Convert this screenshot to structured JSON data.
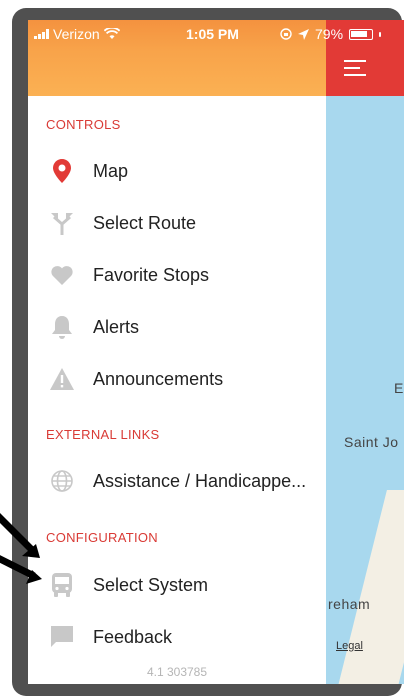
{
  "status_bar": {
    "carrier": "Verizon",
    "time": "1:05 PM",
    "battery": "79%"
  },
  "map": {
    "labels": [
      "E",
      "Saint Jo",
      "reham"
    ],
    "legal_link": "Legal"
  },
  "drawer": {
    "sections": [
      {
        "title": "CONTROLS",
        "items": [
          {
            "label": "Map",
            "icon": "map-pin-icon"
          },
          {
            "label": "Select Route",
            "icon": "route-fork-icon"
          },
          {
            "label": "Favorite Stops",
            "icon": "heart-icon"
          },
          {
            "label": "Alerts",
            "icon": "bell-icon"
          },
          {
            "label": "Announcements",
            "icon": "warning-icon"
          }
        ]
      },
      {
        "title": "EXTERNAL LINKS",
        "items": [
          {
            "label": "Assistance / Handicappe...",
            "icon": "globe-icon"
          }
        ]
      },
      {
        "title": "CONFIGURATION",
        "items": [
          {
            "label": "Select System",
            "icon": "bus-icon"
          },
          {
            "label": "Feedback",
            "icon": "chat-icon"
          }
        ]
      }
    ],
    "version": "4.1 303785"
  },
  "colors": {
    "header_orange": "#f8a34a",
    "accent_red": "#e23a36",
    "map_water": "#a8d8ee",
    "icon_gray": "#c8c8c8"
  }
}
